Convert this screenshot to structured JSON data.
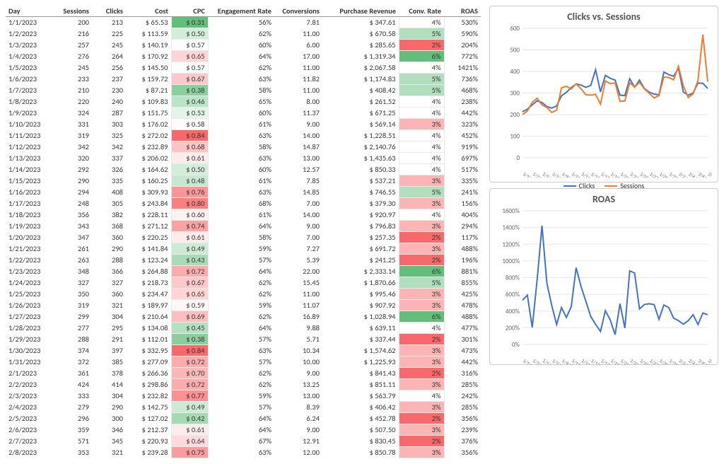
{
  "headers": [
    "Day",
    "Sessions",
    "Clicks",
    "Cost",
    "CPC",
    "Engagement Rate",
    "Conversions",
    "Purchase Revenue",
    "Conv. Rate",
    "ROAS"
  ],
  "rows": [
    {
      "day": "1/1/2023",
      "sessions": 200,
      "clicks": 213,
      "cost": 65.53,
      "cpc": 0.31,
      "eng": 56,
      "conv": 7.81,
      "rev": 347.61,
      "cr": 4,
      "roas": 530
    },
    {
      "day": "1/2/2023",
      "sessions": 216,
      "clicks": 225,
      "cost": 113.59,
      "cpc": 0.5,
      "eng": 62,
      "conv": 11.0,
      "rev": 670.58,
      "cr": 5,
      "roas": 590
    },
    {
      "day": "1/3/2023",
      "sessions": 257,
      "clicks": 245,
      "cost": 140.19,
      "cpc": 0.57,
      "eng": 60,
      "conv": 6.0,
      "rev": 285.65,
      "cr": 2,
      "roas": 204
    },
    {
      "day": "1/4/2023",
      "sessions": 276,
      "clicks": 264,
      "cost": 170.92,
      "cpc": 0.65,
      "eng": 64,
      "conv": 17.0,
      "rev": 1319.34,
      "cr": 6,
      "roas": 772
    },
    {
      "day": "1/5/2023",
      "sessions": 245,
      "clicks": 256,
      "cost": 145.5,
      "cpc": 0.57,
      "eng": 62,
      "conv": 11.0,
      "rev": 2067.58,
      "cr": 4,
      "roas": 1421
    },
    {
      "day": "1/6/2023",
      "sessions": 233,
      "clicks": 237,
      "cost": 159.72,
      "cpc": 0.67,
      "eng": 63,
      "conv": 11.82,
      "rev": 1174.83,
      "cr": 5,
      "roas": 736
    },
    {
      "day": "1/7/2023",
      "sessions": 210,
      "clicks": 230,
      "cost": 87.21,
      "cpc": 0.38,
      "eng": 58,
      "conv": 11.0,
      "rev": 408.42,
      "cr": 5,
      "roas": 468
    },
    {
      "day": "1/8/2023",
      "sessions": 220,
      "clicks": 240,
      "cost": 109.83,
      "cpc": 0.46,
      "eng": 65,
      "conv": 8.0,
      "rev": 261.52,
      "cr": 4,
      "roas": 238
    },
    {
      "day": "1/9/2023",
      "sessions": 324,
      "clicks": 287,
      "cost": 151.75,
      "cpc": 0.53,
      "eng": 60,
      "conv": 11.37,
      "rev": 671.25,
      "cr": 4,
      "roas": 442
    },
    {
      "day": "1/10/2023",
      "sessions": 331,
      "clicks": 303,
      "cost": 176.02,
      "cpc": 0.58,
      "eng": 61,
      "conv": 9.0,
      "rev": 569.14,
      "cr": 3,
      "roas": 323
    },
    {
      "day": "1/11/2023",
      "sessions": 319,
      "clicks": 325,
      "cost": 272.02,
      "cpc": 0.84,
      "eng": 63,
      "conv": 14.0,
      "rev": 1228.51,
      "cr": 4,
      "roas": 452
    },
    {
      "day": "1/12/2023",
      "sessions": 342,
      "clicks": 342,
      "cost": 232.89,
      "cpc": 0.68,
      "eng": 58,
      "conv": 14.87,
      "rev": 2140.76,
      "cr": 4,
      "roas": 919
    },
    {
      "day": "1/13/2023",
      "sessions": 320,
      "clicks": 337,
      "cost": 206.02,
      "cpc": 0.61,
      "eng": 63,
      "conv": 13.0,
      "rev": 1435.63,
      "cr": 4,
      "roas": 697
    },
    {
      "day": "1/14/2023",
      "sessions": 292,
      "clicks": 326,
      "cost": 164.62,
      "cpc": 0.5,
      "eng": 60,
      "conv": 12.57,
      "rev": 850.33,
      "cr": 4,
      "roas": 517
    },
    {
      "day": "1/15/2023",
      "sessions": 290,
      "clicks": 335,
      "cost": 160.25,
      "cpc": 0.48,
      "eng": 61,
      "conv": 7.85,
      "rev": 537.21,
      "cr": 3,
      "roas": 335
    },
    {
      "day": "1/16/2023",
      "sessions": 294,
      "clicks": 408,
      "cost": 309.93,
      "cpc": 0.76,
      "eng": 63,
      "conv": 14.85,
      "rev": 746.55,
      "cr": 5,
      "roas": 241
    },
    {
      "day": "1/17/2023",
      "sessions": 248,
      "clicks": 305,
      "cost": 243.84,
      "cpc": 0.8,
      "eng": 68,
      "conv": 7.0,
      "rev": 379.3,
      "cr": 3,
      "roas": 156
    },
    {
      "day": "1/18/2023",
      "sessions": 356,
      "clicks": 382,
      "cost": 228.11,
      "cpc": 0.6,
      "eng": 61,
      "conv": 14.0,
      "rev": 920.97,
      "cr": 4,
      "roas": 404
    },
    {
      "day": "1/19/2023",
      "sessions": 343,
      "clicks": 368,
      "cost": 271.12,
      "cpc": 0.74,
      "eng": 64,
      "conv": 9.0,
      "rev": 796.83,
      "cr": 3,
      "roas": 294
    },
    {
      "day": "1/20/2023",
      "sessions": 347,
      "clicks": 360,
      "cost": 220.25,
      "cpc": 0.61,
      "eng": 58,
      "conv": 7.0,
      "rev": 257.35,
      "cr": 2,
      "roas": 117
    },
    {
      "day": "1/21/2023",
      "sessions": 261,
      "clicks": 290,
      "cost": 141.84,
      "cpc": 0.49,
      "eng": 59,
      "conv": 7.27,
      "rev": 691.72,
      "cr": 3,
      "roas": 488
    },
    {
      "day": "1/22/2023",
      "sessions": 263,
      "clicks": 288,
      "cost": 123.24,
      "cpc": 0.43,
      "eng": 57,
      "conv": 5.39,
      "rev": 241.25,
      "cr": 2,
      "roas": 196
    },
    {
      "day": "1/23/2023",
      "sessions": 348,
      "clicks": 366,
      "cost": 264.88,
      "cpc": 0.72,
      "eng": 64,
      "conv": 22.0,
      "rev": 2333.14,
      "cr": 6,
      "roas": 881
    },
    {
      "day": "1/24/2023",
      "sessions": 327,
      "clicks": 327,
      "cost": 218.73,
      "cpc": 0.67,
      "eng": 62,
      "conv": 15.45,
      "rev": 1870.66,
      "cr": 5,
      "roas": 855
    },
    {
      "day": "1/25/2023",
      "sessions": 350,
      "clicks": 360,
      "cost": 234.47,
      "cpc": 0.65,
      "eng": 62,
      "conv": 11.0,
      "rev": 995.46,
      "cr": 3,
      "roas": 425
    },
    {
      "day": "1/26/2023",
      "sessions": 319,
      "clicks": 321,
      "cost": 189.97,
      "cpc": 0.59,
      "eng": 59,
      "conv": 11.07,
      "rev": 907.92,
      "cr": 3,
      "roas": 478
    },
    {
      "day": "1/27/2023",
      "sessions": 299,
      "clicks": 304,
      "cost": 210.64,
      "cpc": 0.69,
      "eng": 62,
      "conv": 16.89,
      "rev": 1028.94,
      "cr": 6,
      "roas": 488
    },
    {
      "day": "1/28/2023",
      "sessions": 277,
      "clicks": 295,
      "cost": 134.08,
      "cpc": 0.45,
      "eng": 64,
      "conv": 9.88,
      "rev": 639.11,
      "cr": 4,
      "roas": 477
    },
    {
      "day": "1/29/2023",
      "sessions": 288,
      "clicks": 291,
      "cost": 112.01,
      "cpc": 0.38,
      "eng": 57,
      "conv": 5.71,
      "rev": 337.44,
      "cr": 2,
      "roas": 301
    },
    {
      "day": "1/30/2023",
      "sessions": 374,
      "clicks": 397,
      "cost": 332.95,
      "cpc": 0.84,
      "eng": 63,
      "conv": 10.34,
      "rev": 1574.62,
      "cr": 3,
      "roas": 473
    },
    {
      "day": "1/31/2023",
      "sessions": 372,
      "clicks": 385,
      "cost": 277.09,
      "cpc": 0.72,
      "eng": 57,
      "conv": 10.0,
      "rev": 1225.93,
      "cr": 3,
      "roas": 442
    },
    {
      "day": "2/1/2023",
      "sessions": 361,
      "clicks": 378,
      "cost": 266.36,
      "cpc": 0.7,
      "eng": 62,
      "conv": 9.0,
      "rev": 841.43,
      "cr": 2,
      "roas": 316
    },
    {
      "day": "2/2/2023",
      "sessions": 424,
      "clicks": 414,
      "cost": 298.86,
      "cpc": 0.72,
      "eng": 62,
      "conv": 13.25,
      "rev": 851.11,
      "cr": 3,
      "roas": 285
    },
    {
      "day": "2/3/2023",
      "sessions": 333,
      "clicks": 304,
      "cost": 232.82,
      "cpc": 0.77,
      "eng": 59,
      "conv": 13.0,
      "rev": 563.79,
      "cr": 4,
      "roas": 242
    },
    {
      "day": "2/4/2023",
      "sessions": 279,
      "clicks": 290,
      "cost": 142.75,
      "cpc": 0.49,
      "eng": 57,
      "conv": 8.39,
      "rev": 406.42,
      "cr": 3,
      "roas": 285
    },
    {
      "day": "2/5/2023",
      "sessions": 296,
      "clicks": 300,
      "cost": 127.02,
      "cpc": 0.42,
      "eng": 64,
      "conv": 6.24,
      "rev": 452.78,
      "cr": 2,
      "roas": 356
    },
    {
      "day": "2/6/2023",
      "sessions": 359,
      "clicks": 346,
      "cost": 212.37,
      "cpc": 0.61,
      "eng": 64,
      "conv": 9.0,
      "rev": 507.5,
      "cr": 3,
      "roas": 239
    },
    {
      "day": "2/7/2023",
      "sessions": 571,
      "clicks": 345,
      "cost": 220.93,
      "cpc": 0.64,
      "eng": 67,
      "conv": 12.91,
      "rev": 830.45,
      "cr": 2,
      "roas": 376
    },
    {
      "day": "2/8/2023",
      "sessions": 353,
      "clicks": 321,
      "cost": 239.28,
      "cpc": 0.75,
      "eng": 63,
      "conv": 12.0,
      "rev": 850.78,
      "cr": 3,
      "roas": 356
    }
  ],
  "chart_data": [
    {
      "type": "line",
      "title": "Clicks vs. Sessions",
      "ylim": [
        0,
        600
      ],
      "yticks": [
        0,
        100,
        200,
        300,
        400,
        500,
        600
      ],
      "x": [
        "1/1/2023",
        "1/3/2023",
        "1/5/2023",
        "1/7/2023",
        "1/9/2023",
        "1/11/2023",
        "1/13/2023",
        "1/15/2023",
        "1/17/2023",
        "1/19/2023",
        "1/21/2023",
        "1/23/2023",
        "1/25/2023",
        "1/27/2023",
        "1/29/2023",
        "1/31/2023",
        "2/2/2023",
        "2/4/2023",
        "2/6/2023",
        "2/8/2023"
      ],
      "series": [
        {
          "name": "Clicks",
          "color": "#4472c4",
          "values": [
            213,
            225,
            245,
            264,
            256,
            237,
            230,
            240,
            287,
            303,
            325,
            342,
            337,
            326,
            335,
            408,
            305,
            382,
            368,
            360,
            290,
            288,
            366,
            327,
            360,
            321,
            304,
            295,
            291,
            397,
            385,
            378,
            414,
            304,
            290,
            300,
            346,
            345,
            321
          ]
        },
        {
          "name": "Sessions",
          "color": "#ed7d31",
          "values": [
            200,
            216,
            257,
            276,
            245,
            233,
            210,
            220,
            324,
            331,
            319,
            342,
            320,
            292,
            290,
            294,
            248,
            356,
            343,
            347,
            261,
            263,
            348,
            327,
            350,
            319,
            299,
            277,
            288,
            374,
            372,
            361,
            424,
            333,
            279,
            296,
            359,
            571,
            353
          ]
        }
      ]
    },
    {
      "type": "line",
      "title": "ROAS",
      "ylim": [
        0,
        1600
      ],
      "yticks": [
        0,
        200,
        400,
        600,
        800,
        1000,
        1200,
        1400,
        1600
      ],
      "yformat": "%",
      "x": [
        "1/1/2023",
        "1/3/2023",
        "1/5/2023",
        "1/7/2023",
        "1/9/2023",
        "1/11/2023",
        "1/13/2023",
        "1/15/2023",
        "1/17/2023",
        "1/19/2023",
        "1/21/2023",
        "1/23/2023",
        "1/25/2023",
        "1/27/2023",
        "1/29/2023",
        "1/31/2023",
        "2/2/2023",
        "2/4/2023",
        "2/6/2023",
        "2/8/2023"
      ],
      "series": [
        {
          "name": "ROAS",
          "color": "#4472c4",
          "values": [
            530,
            590,
            204,
            772,
            1421,
            736,
            468,
            238,
            442,
            323,
            452,
            919,
            697,
            517,
            335,
            241,
            156,
            404,
            294,
            117,
            488,
            196,
            881,
            855,
            425,
            478,
            488,
            477,
            301,
            473,
            442,
            316,
            285,
            242,
            285,
            356,
            239,
            376,
            356
          ]
        }
      ]
    }
  ],
  "colors": {
    "goodGreen": "#63be7b",
    "midYellow": "#ffeb84",
    "badRed": "#f8696b"
  }
}
